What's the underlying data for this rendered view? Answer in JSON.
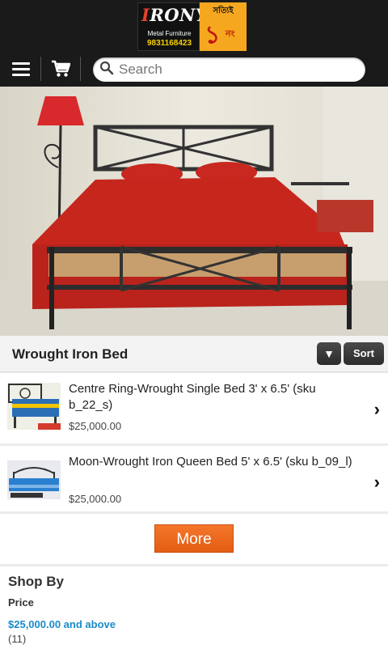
{
  "header": {
    "logo": {
      "brand": "IRONY",
      "subtitle": "Metal Furniture",
      "phone": "9831168423",
      "tagline_top": "সত্যিই",
      "tagline_num": "১",
      "tagline_suffix": "নং"
    },
    "search": {
      "placeholder": "Search"
    }
  },
  "category": {
    "title": "Wrought Iron Bed",
    "dropdown_glyph": "▼",
    "sort_label": "Sort"
  },
  "products": [
    {
      "name": "Centre Ring-Wrought Single Bed 3' x 6.5' (sku b_22_s)",
      "price": "$25,000.00"
    },
    {
      "name": "Moon-Wrought Iron Queen Bed 5' x 6.5' (sku b_09_l)",
      "price": "$25,000.00"
    }
  ],
  "more_label": "More",
  "shop_by": {
    "title": "Shop By",
    "filter_label": "Price",
    "option_label": "$25,000.00 and above",
    "option_count": "(11)"
  },
  "icons": {
    "menu": "menu-icon",
    "cart": "cart-icon",
    "search": "search-icon",
    "chevron": "chevron-right-icon"
  },
  "colors": {
    "header_bg": "#1a1a1a",
    "accent_orange": "#e8641a",
    "link_blue": "#1a8bc8"
  }
}
